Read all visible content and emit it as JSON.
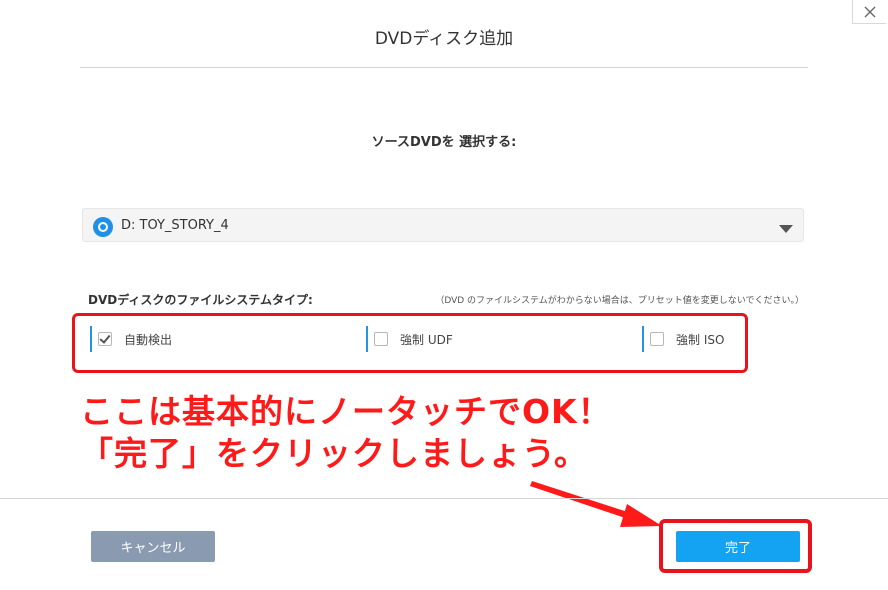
{
  "dialog": {
    "title": "DVDディスク追加",
    "close_icon": "close-icon"
  },
  "source": {
    "label": "ソースDVDを 選択する:",
    "selected_disc": "D: TOY_STORY_4",
    "disc_icon": "disc-icon",
    "arrow_icon": "dropdown-arrow-icon"
  },
  "filesystem": {
    "label": "DVDディスクのファイルシステムタイプ:",
    "hint": "（DVD のファイルシステムがわからない場合は、プリセット値を変更しないでください。）",
    "options": [
      {
        "label": "自動検出",
        "checked": true
      },
      {
        "label": "強制 UDF",
        "checked": false
      },
      {
        "label": "強制 ISO",
        "checked": false
      }
    ]
  },
  "annotation": {
    "line1": "ここは基本的にノータッチでOK！",
    "line2": "「完了」をクリックしましょう。",
    "color": "#ff1a1a"
  },
  "footer": {
    "cancel_label": "キャンセル",
    "done_label": "完了"
  },
  "colors": {
    "accent": "#13a3f2",
    "cancel": "#8a9bb1",
    "highlight": "#e8131b"
  }
}
